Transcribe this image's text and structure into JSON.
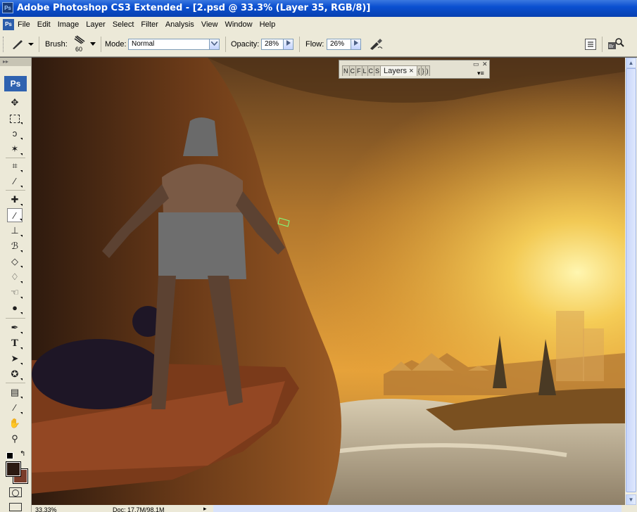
{
  "window": {
    "title": "Adobe Photoshop CS3 Extended - [2.psd @ 33.3% (Layer 35, RGB/8)]",
    "app_icon": "Ps"
  },
  "menu": {
    "items": [
      "File",
      "Edit",
      "Image",
      "Layer",
      "Select",
      "Filter",
      "Analysis",
      "View",
      "Window",
      "Help"
    ]
  },
  "options": {
    "brush_label": "Brush:",
    "brush_size": "60",
    "mode_label": "Mode:",
    "mode_value": "Normal",
    "opacity_label": "Opacity:",
    "opacity_value": "28%",
    "flow_label": "Flow:",
    "flow_value": "26%"
  },
  "toolbox": {
    "logo": "Ps"
  },
  "layers_panel": {
    "tab_label": "Layers",
    "close_glyph": "×"
  },
  "status": {
    "zoom": "33.33%",
    "doc": "Doc: 17.7M/98.1M"
  },
  "colors": {
    "foreground": "#2b1a12",
    "background": "#7a3d2a",
    "accent": "#0a4fd0"
  }
}
